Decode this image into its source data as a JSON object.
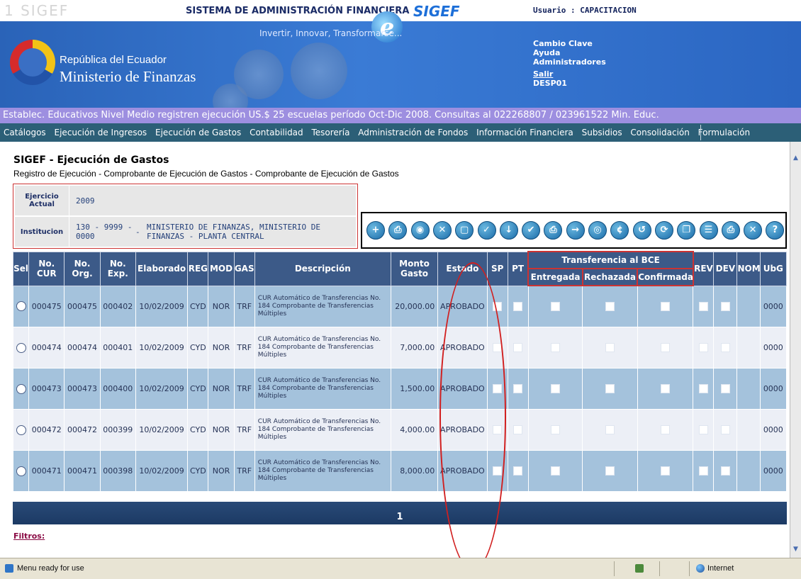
{
  "header": {
    "ghost_logo": "1 SIGEF",
    "system_name": "SISTEMA DE ADMINISTRACIÓN FINANCIERA",
    "brand": "SIGEF",
    "slogan": "Invertir, Innovar, Transformarse...",
    "republica": "República del Ecuador",
    "ministerio": "Ministerio de Finanzas",
    "user": "Usuario : CAPACITACION",
    "links": {
      "cambio_clave": "Cambio Clave",
      "ayuda": "Ayuda",
      "administradores": "Administradores",
      "salir": "Salir",
      "code": "DESP01"
    },
    "colors": {
      "band": "#2a63b8",
      "announce": "#9d8fe0",
      "menu": "#2c5f77"
    }
  },
  "announcement": "Establec. Educativos Nivel Medio registren ejecución US.$ 25 escuelas período Oct-Dic 2008. Consultas al 022268807 / 023961522 Min. Educ.",
  "menu": [
    "Catálogos",
    "Ejecución de Ingresos",
    "Ejecución de Gastos",
    "Contabilidad",
    "Tesorería",
    "Administración de Fondos",
    "Información Financiera",
    "Subsidios",
    "Consolidación",
    "Formulación"
  ],
  "page": {
    "title": "SIGEF - Ejecución de Gastos",
    "breadcrumb": "Registro de Ejecución - Comprobante de Ejecución de Gastos - Comprobante de Ejecución de Gastos"
  },
  "info": {
    "ejercicio_label": "Ejercicio Actual",
    "ejercicio_value": "2009",
    "institucion_label": "Institucion",
    "institucion_code": "130 - 9999 - 0000",
    "institucion_dash": "-",
    "institucion_name": "MINISTERIO DE FINANZAS, MINISTERIO DE FINANZAS - PLANTA CENTRAL"
  },
  "toolbar": {
    "icons": [
      "add-doc-icon",
      "save-doc-icon",
      "view-doc-icon",
      "delete-doc-icon",
      "clipboard-icon",
      "approve-doc-icon",
      "verify-icon",
      "check-icon",
      "print-icon",
      "next-doc-icon",
      "search-doc-icon",
      "currency-icon",
      "history-icon",
      "refresh-icon",
      "copy-doc-icon",
      "list-doc-icon",
      "print-alt-icon",
      "close-icon",
      "help-icon"
    ],
    "glyphs": [
      "+",
      "⎙",
      "◉",
      "✕",
      "▢",
      "✓",
      "↓",
      "✔",
      "⎙",
      "→",
      "◎",
      "¢",
      "↺",
      "⟳",
      "❐",
      "☰",
      "⎙",
      "✕",
      "?"
    ]
  },
  "table": {
    "headers": {
      "sel": "Sel",
      "cur": "No. CUR",
      "org": "No. Org.",
      "exp": "No. Exp.",
      "elaborado": "Elaborado",
      "reg": "REG",
      "mod": "MOD",
      "gas": "GAS",
      "descripcion": "Descripción",
      "monto": "Monto Gasto",
      "estado": "Estado",
      "sp": "SP",
      "pt": "PT",
      "transfer": "Transferencia al BCE",
      "entregada": "Entregada",
      "rechazada": "Rechazada",
      "confirmada": "Confirmada",
      "rev": "REV",
      "dev": "DEV",
      "nom": "NOM",
      "ubg": "UbG"
    },
    "rows": [
      {
        "cur": "000475",
        "org": "000475",
        "exp": "000402",
        "elaborado": "10/02/2009",
        "reg": "CYD",
        "mod": "NOR",
        "gas": "TRF",
        "descripcion": "CUR Automático de Transferencias No. 184 Comprobante de Transferencias Múltiples",
        "monto": "20,000.00",
        "estado": "APROBADO",
        "ubg": "0000"
      },
      {
        "cur": "000474",
        "org": "000474",
        "exp": "000401",
        "elaborado": "10/02/2009",
        "reg": "CYD",
        "mod": "NOR",
        "gas": "TRF",
        "descripcion": "CUR Automático de Transferencias No. 184 Comprobante de Transferencias Múltiples",
        "monto": "7,000.00",
        "estado": "APROBADO",
        "ubg": "0000"
      },
      {
        "cur": "000473",
        "org": "000473",
        "exp": "000400",
        "elaborado": "10/02/2009",
        "reg": "CYD",
        "mod": "NOR",
        "gas": "TRF",
        "descripcion": "CUR Automático de Transferencias No. 184 Comprobante de Transferencias Múltiples",
        "monto": "1,500.00",
        "estado": "APROBADO",
        "ubg": "0000"
      },
      {
        "cur": "000472",
        "org": "000472",
        "exp": "000399",
        "elaborado": "10/02/2009",
        "reg": "CYD",
        "mod": "NOR",
        "gas": "TRF",
        "descripcion": "CUR Automático de Transferencias No. 184 Comprobante de Transferencias Múltiples",
        "monto": "4,000.00",
        "estado": "APROBADO",
        "ubg": "0000"
      },
      {
        "cur": "000471",
        "org": "000471",
        "exp": "000398",
        "elaborado": "10/02/2009",
        "reg": "CYD",
        "mod": "NOR",
        "gas": "TRF",
        "descripcion": "CUR Automático de Transferencias No. 184 Comprobante de Transferencias Múltiples",
        "monto": "8,000.00",
        "estado": "APROBADO",
        "ubg": "0000"
      }
    ]
  },
  "pager": {
    "page": "1"
  },
  "filtros": "Filtros:",
  "statusbar": {
    "text": "Menu ready for use",
    "zone": "Internet"
  }
}
